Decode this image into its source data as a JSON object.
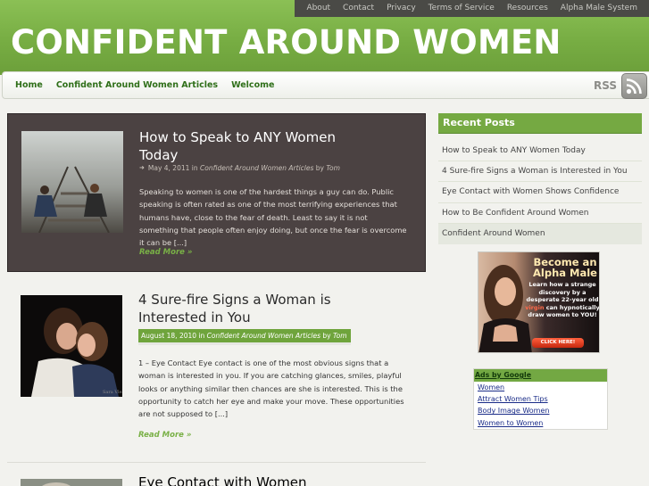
{
  "topnav": [
    "About",
    "Contact",
    "Privacy",
    "Terms of Service",
    "Resources",
    "Alpha Male System"
  ],
  "site_title": "CONFIDENT AROUND WOMEN",
  "mainnav": [
    "Home",
    "Confident Around Women Articles",
    "Welcome"
  ],
  "rss_label": "RSS",
  "posts": [
    {
      "title": "How to Speak to ANY Women Today",
      "date": "May 4, 2011",
      "in": "in",
      "category": "Confident Around Women Articles",
      "by": "by",
      "author": "Tom",
      "excerpt": "Speaking to women is one of the hardest things a guy can do. Public speaking is often rated as one of the most terrifying experiences that humans have, close to the fear of death. Least to say it is not something that people often enjoy doing, but once the fear is overcome it can be [...]",
      "read_more": "Read More »"
    },
    {
      "title": "4 Sure-fire Signs a Woman is Interested in You",
      "date": "August 18, 2010",
      "in": "in",
      "category": "Confident Around Women Articles",
      "by": "by",
      "author": "Tom",
      "excerpt": "1 – Eye Contact Eye contact is one of the most obvious signs that a woman is interested in you. If you are catching glances, smiles, playful looks or anything similar then chances are she is interested. This is the opportunity to catch her eye and make your move. These opportunities are not supposed to [...]",
      "read_more": "Read More »"
    },
    {
      "title": "Eye Contact with Women"
    }
  ],
  "sidebar": {
    "recent_title": "Recent Posts",
    "recent_posts": [
      "How to Speak to ANY Women Today",
      "4 Sure-fire Signs a Woman is Interested in You",
      "Eye Contact with Women Shows Confidence",
      "How to Be Confident Around Women",
      "Confident Around Women"
    ],
    "ad": {
      "line1": "Become an",
      "line2": "Alpha Male",
      "body_a": "Learn how a strange discovery by a desperate 22-year old",
      "body_hl": "virgin",
      "body_b": "can hypnotically draw women to YOU!",
      "button": "CLICK HERE!"
    },
    "ads_by_google": {
      "heading": "Ads by Google",
      "links": [
        "Women",
        "Attract Women Tips",
        "Body Image Women",
        "Women to Women"
      ]
    }
  },
  "colors": {
    "brand_green": "#77ad43",
    "link_green": "#2f6f19",
    "featured_bg": "#4b4242",
    "top_bar": "#4a4a46"
  }
}
